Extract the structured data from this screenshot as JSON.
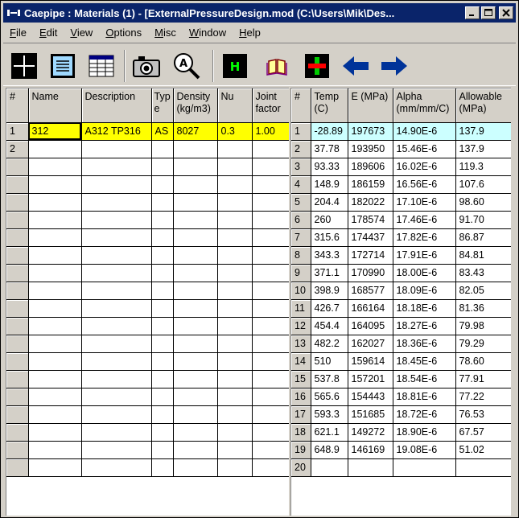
{
  "window": {
    "title": "Caepipe : Materials  (1)  -  [ExternalPressureDesign.mod (C:\\Users\\Mik\\Des...",
    "minimize": "_",
    "maximize": "□",
    "close": "×"
  },
  "menu": [
    {
      "u": "F",
      "rest": "ile"
    },
    {
      "u": "E",
      "rest": "dit"
    },
    {
      "u": "V",
      "rest": "iew"
    },
    {
      "u": "O",
      "rest": "ptions"
    },
    {
      "u": "M",
      "rest": "isc"
    },
    {
      "u": "W",
      "rest": "indow"
    },
    {
      "u": "H",
      "rest": "elp"
    }
  ],
  "toolbar": {
    "tools": [
      "crosshair-icon",
      "list-view-icon",
      "table-view-icon",
      "camera-icon",
      "zoom-search-icon",
      "help-h-icon",
      "book-icon",
      "add-cross-icon",
      "arrow-left-icon",
      "arrow-right-icon"
    ],
    "help_letter": "H",
    "zoom_letter": "A"
  },
  "colors": {
    "titlebar": "#0a246a",
    "highlight_yellow": "#ffff00",
    "highlight_cyan": "#ccffff"
  },
  "materials": {
    "headers": [
      "#",
      "Name",
      "Description",
      "Type",
      "Density (kg/m3)",
      "Nu",
      "Joint factor"
    ],
    "rows": [
      [
        "1",
        "312",
        "A312 TP316",
        "AS",
        "8027",
        "0.3",
        "1.00"
      ],
      [
        "2",
        "",
        "",
        "",
        "",
        "",
        ""
      ]
    ]
  },
  "properties": {
    "headers": [
      "#",
      "Temp (C)",
      "E (MPa)",
      "Alpha (mm/mm/C)",
      "Allowable (MPa)"
    ],
    "rows": [
      [
        "1",
        "-28.89",
        "197673",
        "14.90E-6",
        "137.9"
      ],
      [
        "2",
        "37.78",
        "193950",
        "15.46E-6",
        "137.9"
      ],
      [
        "3",
        "93.33",
        "189606",
        "16.02E-6",
        "119.3"
      ],
      [
        "4",
        "148.9",
        "186159",
        "16.56E-6",
        "107.6"
      ],
      [
        "5",
        "204.4",
        "182022",
        "17.10E-6",
        "98.60"
      ],
      [
        "6",
        "260",
        "178574",
        "17.46E-6",
        "91.70"
      ],
      [
        "7",
        "315.6",
        "174437",
        "17.82E-6",
        "86.87"
      ],
      [
        "8",
        "343.3",
        "172714",
        "17.91E-6",
        "84.81"
      ],
      [
        "9",
        "371.1",
        "170990",
        "18.00E-6",
        "83.43"
      ],
      [
        "10",
        "398.9",
        "168577",
        "18.09E-6",
        "82.05"
      ],
      [
        "11",
        "426.7",
        "166164",
        "18.18E-6",
        "81.36"
      ],
      [
        "12",
        "454.4",
        "164095",
        "18.27E-6",
        "79.98"
      ],
      [
        "13",
        "482.2",
        "162027",
        "18.36E-6",
        "79.29"
      ],
      [
        "14",
        "510",
        "159614",
        "18.45E-6",
        "78.60"
      ],
      [
        "15",
        "537.8",
        "157201",
        "18.54E-6",
        "77.91"
      ],
      [
        "16",
        "565.6",
        "154443",
        "18.81E-6",
        "77.22"
      ],
      [
        "17",
        "593.3",
        "151685",
        "18.72E-6",
        "76.53"
      ],
      [
        "18",
        "621.1",
        "149272",
        "18.90E-6",
        "67.57"
      ],
      [
        "19",
        "648.9",
        "146169",
        "19.08E-6",
        "51.02"
      ],
      [
        "20",
        "",
        "",
        "",
        ""
      ]
    ]
  }
}
